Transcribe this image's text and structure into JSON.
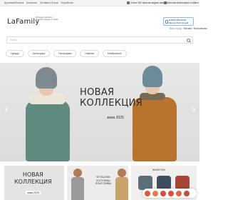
{
  "topbar": {
    "links": [
      "Доставка/Оплата",
      "Контакты",
      "Оставить Отзыв",
      "Устройство"
    ],
    "promo_delivery": "Более 300 пунктов выдачи заказов",
    "promo_returns": "Бесплатный возврат и обмен"
  },
  "header": {
    "logo": "LaFamily",
    "tagline": "Интернет-магазин детской одежды и обуви",
    "phone_line1": "8 (800) 000-00-00",
    "phone_line2": "Звонок бесплатный",
    "city_prefix": "Ваш город:",
    "city": "Москва / Московская"
  },
  "search": {
    "placeholder": "Поиск"
  },
  "categories": [
    "Одежда",
    "Аксессуары",
    "Распродажа",
    "Новинки",
    "Мембранный"
  ],
  "hero": {
    "title_line1": "НОВАЯ",
    "title_line2": "КОЛЛЕКЦИЯ",
    "subtitle": "зима 2025"
  },
  "tiles": {
    "tile1_title_line1": "НОВАЯ",
    "tile1_title_line2": "КОЛЛЕКЦИЯ",
    "tile1_sub": "зима 2025",
    "tile2_text": "ФУТБОЛКИ КОСТЮМЫ ЛОНГСЛИВЫ",
    "tile3_text": "ЖИЛЕТКИ"
  },
  "colors": {
    "accent": "#8fbcd6",
    "chat": "#e05a3a"
  }
}
